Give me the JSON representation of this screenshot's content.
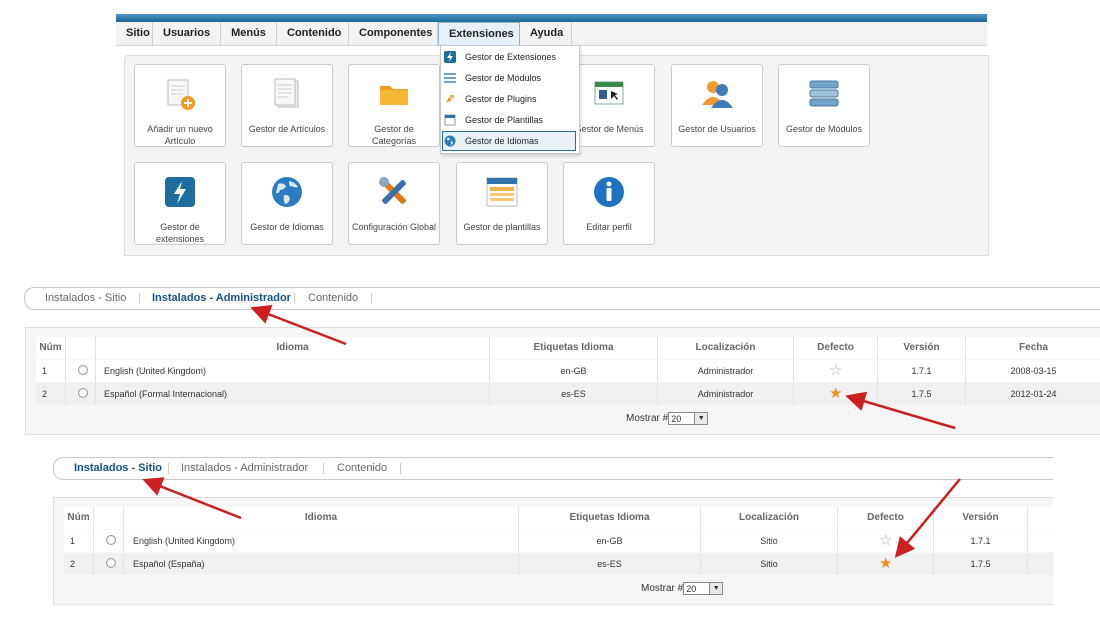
{
  "top_menu": {
    "items": [
      "Sitio",
      "Usuarios",
      "Menús",
      "Contenido",
      "Componentes",
      "Extensiones",
      "Ayuda"
    ],
    "active": "Extensiones"
  },
  "dropdown": {
    "items": [
      "Gestor de Extensiones",
      "Gestor de Módulos",
      "Gestor de Plugins",
      "Gestor de Plantillas",
      "Gestor de Idiomas"
    ],
    "highlighted": "Gestor de Idiomas"
  },
  "cpanel": {
    "row1": [
      {
        "label": "Añadir un nuevo Artículo",
        "icon": "add-article-icon"
      },
      {
        "label": "Gestor de Artículos",
        "icon": "articles-icon"
      },
      {
        "label": "Gestor de Categorías",
        "icon": "folder-icon"
      },
      {
        "label": "Gestor de Menús",
        "icon": "menus-icon"
      },
      {
        "label": "Gestor de Usuarios",
        "icon": "users-icon"
      },
      {
        "label": "Gestor de Módulos",
        "icon": "modules-icon"
      }
    ],
    "row2": [
      {
        "label": "Gestor de extensiones",
        "icon": "extensions-icon"
      },
      {
        "label": "Gestor de Idiomas",
        "icon": "globe-icon"
      },
      {
        "label": "Configuración Global",
        "icon": "tools-icon"
      },
      {
        "label": "Gestor de plantillas",
        "icon": "template-icon"
      },
      {
        "label": "Editar perfil",
        "icon": "info-icon"
      }
    ]
  },
  "admin_panel": {
    "tabs": [
      "Instalados - Sitio",
      "Instalados - Administrador",
      "Contenido"
    ],
    "active_tab": "Instalados - Administrador",
    "columns": [
      "Núm",
      "Idioma",
      "Etiquetas Idioma",
      "Localización",
      "Defecto",
      "Versión",
      "Fecha"
    ],
    "rows": [
      {
        "num": "1",
        "idioma": "English (United Kingdom)",
        "etiqueta": "en-GB",
        "localizacion": "Administrador",
        "defecto": false,
        "version": "1.7.1",
        "fecha": "2008-03-15"
      },
      {
        "num": "2",
        "idioma": "Español (Formal Internacional)",
        "etiqueta": "es-ES",
        "localizacion": "Administrador",
        "defecto": true,
        "version": "1.7.5",
        "fecha": "2012-01-24"
      }
    ],
    "pager_label": "Mostrar #",
    "pager_value": "20"
  },
  "site_panel": {
    "tabs": [
      "Instalados - Sitio",
      "Instalados - Administrador",
      "Contenido"
    ],
    "active_tab": "Instalados - Sitio",
    "columns": [
      "Núm",
      "Idioma",
      "Etiquetas Idioma",
      "Localización",
      "Defecto",
      "Versión"
    ],
    "rows": [
      {
        "num": "1",
        "idioma": "English (United Kingdom)",
        "etiqueta": "en-GB",
        "localizacion": "Sitio",
        "defecto": false,
        "version": "1.7.1"
      },
      {
        "num": "2",
        "idioma": "Español (España)",
        "etiqueta": "es-ES",
        "localizacion": "Sitio",
        "defecto": true,
        "version": "1.7.5"
      }
    ],
    "pager_label": "Mostrar #",
    "pager_value": "20"
  },
  "colors": {
    "accent": "#15508a",
    "arrow": "#cc1f1f",
    "star_default": "#f0901a",
    "star_empty": "#b8b8b8"
  }
}
